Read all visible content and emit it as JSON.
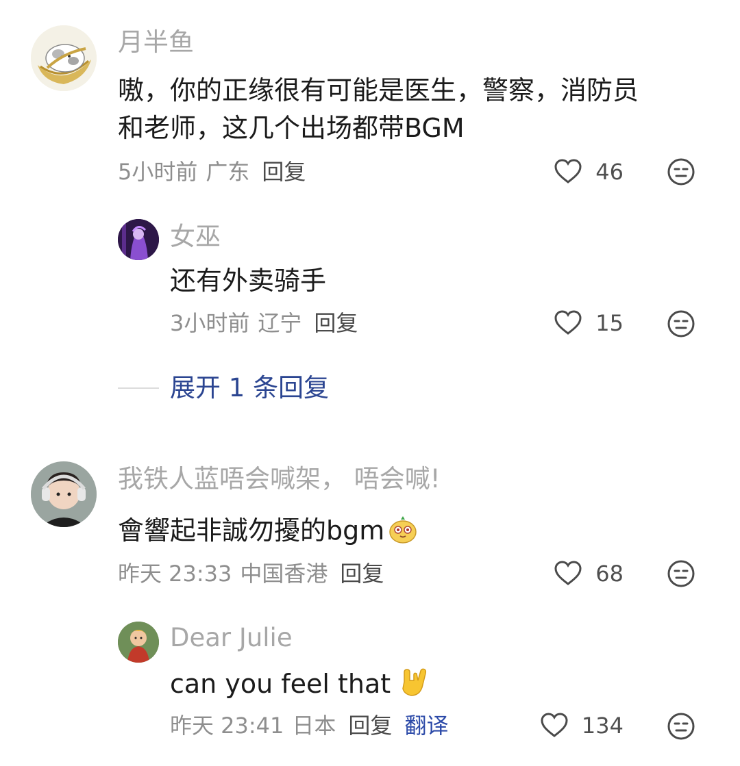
{
  "comments": [
    {
      "username": "月半鱼",
      "text_line1": "嗷，你的正缘很有可能是医生，警察，消防员",
      "text_line2": "和老师，这几个出场都带BGM",
      "time": "5小时前",
      "region": "广东",
      "reply_label": "回复",
      "likes": "46",
      "avatar_icon": "cat-in-bowl-avatar"
    },
    {
      "username": "女巫",
      "text": "还有外卖骑手",
      "time": "3小时前",
      "region": "辽宁",
      "reply_label": "回复",
      "likes": "15",
      "avatar_icon": "purple-anime-avatar"
    },
    {
      "username": "我铁人蓝唔会喊架， 唔会喊!",
      "text": "會響起非誠勿擾的bgm",
      "time": "昨天 23:33",
      "region": "中国香港",
      "reply_label": "回复",
      "likes": "68",
      "avatar_icon": "child-headphones-avatar",
      "emoji": "yellow-face-emoji"
    },
    {
      "username": "Dear Julie",
      "text": "can you feel that",
      "time": "昨天 23:41",
      "region": "日本",
      "reply_label": "回复",
      "translate_label": "翻译",
      "likes": "134",
      "avatar_icon": "cartoon-character-avatar",
      "emoji": "rock-hand-emoji"
    }
  ],
  "expand_replies": {
    "label": "展开 1 条回复"
  },
  "colors": {
    "username": "#a7a7a7",
    "body": "#1b1b1b",
    "meta": "#8e8e8e",
    "link": "#2b4591",
    "translate": "#2c4aa8"
  }
}
